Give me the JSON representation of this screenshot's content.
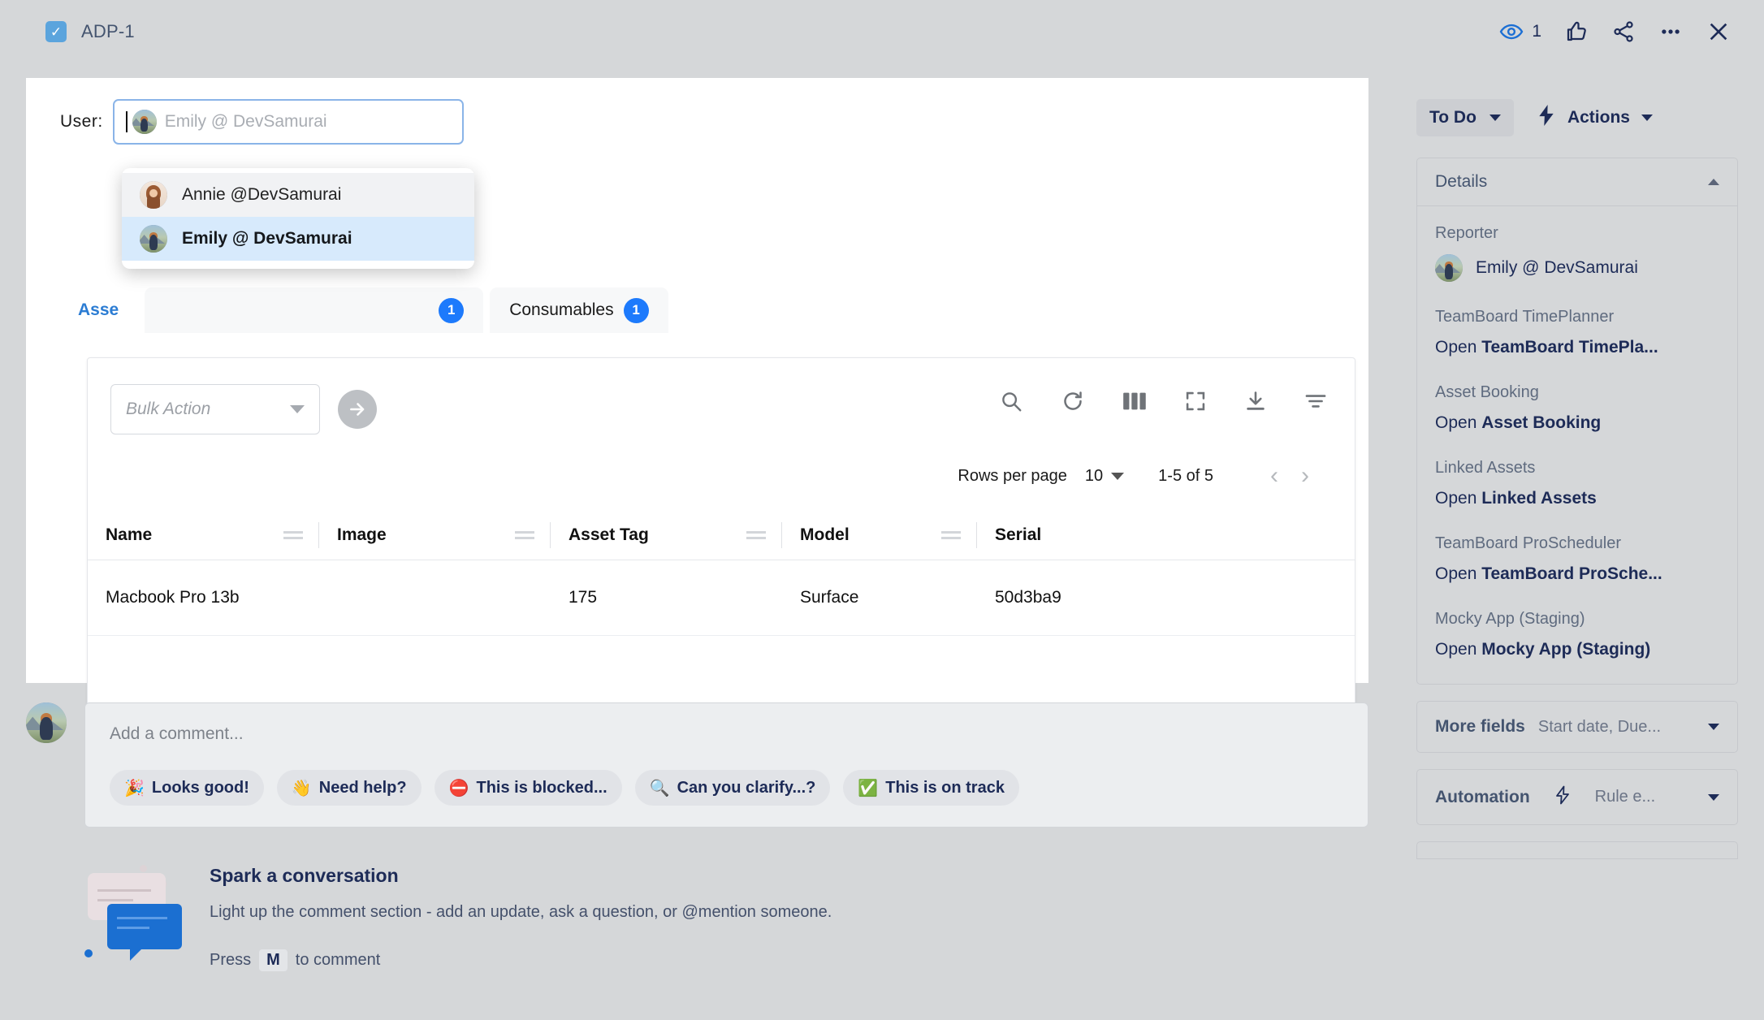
{
  "topbar": {
    "issue_key": "ADP-1",
    "check_glyph": "✓",
    "watch_count": "1",
    "icons": [
      "watch-eye-icon",
      "thumbs-up-icon",
      "share-icon",
      "more-actions-icon",
      "close-icon"
    ]
  },
  "user_field": {
    "label": "User:",
    "placeholder": "Emily @ DevSamurai",
    "value": ""
  },
  "dropdown": {
    "options": [
      {
        "name": "Annie @DevSamurai",
        "state": "hover"
      },
      {
        "name": "Emily @ DevSamurai",
        "state": "selected"
      }
    ]
  },
  "tabs": [
    {
      "label": "Asse",
      "badge": "",
      "active": true
    },
    {
      "label": "",
      "badge": "1",
      "active": false
    },
    {
      "label": "Consumables",
      "badge": "1",
      "active": false
    }
  ],
  "table_panel": {
    "bulk_action_placeholder": "Bulk Action",
    "go_button": "→",
    "tools": [
      "search-icon",
      "refresh-icon",
      "columns-icon",
      "fullscreen-icon",
      "download-icon",
      "filter-icon"
    ],
    "pagination": {
      "rows_per_page_label": "Rows per page",
      "rows_per_page_value": "10",
      "range": "1-5 of 5",
      "prev": "‹",
      "next": "›"
    },
    "columns": [
      "Name",
      "Image",
      "Asset Tag",
      "Model",
      "Serial"
    ],
    "rows": [
      {
        "name": "Macbook Pro 13b",
        "image": "",
        "asset_tag": "175",
        "model": "Surface",
        "serial": "50d3ba9"
      }
    ]
  },
  "comment": {
    "placeholder": "Add a comment...",
    "chips": [
      {
        "emoji": "🎉",
        "label": "Looks good!"
      },
      {
        "emoji": "👋",
        "label": "Need help?"
      },
      {
        "emoji": "⛔",
        "label": "This is blocked..."
      },
      {
        "emoji": "🔍",
        "label": "Can you clarify...?"
      },
      {
        "emoji": "✅",
        "label": "This is on track"
      }
    ],
    "spark": {
      "title": "Spark a conversation",
      "subtitle": "Light up the comment section - add an update, ask a question, or @mention someone.",
      "press_prefix": "Press",
      "press_key": "M",
      "press_suffix": "to comment"
    }
  },
  "sidebar": {
    "status": "To Do",
    "actions_label": "Actions",
    "details": {
      "title": "Details",
      "fields": [
        {
          "label": "Reporter",
          "type": "user",
          "value": "Emily @ DevSamurai"
        },
        {
          "label": "TeamBoard TimePlanner",
          "type": "link",
          "prefix": "Open ",
          "link": "TeamBoard TimePla..."
        },
        {
          "label": "Asset Booking",
          "type": "link",
          "prefix": "Open ",
          "link": "Asset Booking"
        },
        {
          "label": "Linked Assets",
          "type": "link",
          "prefix": "Open ",
          "link": "Linked Assets"
        },
        {
          "label": "TeamBoard ProScheduler",
          "type": "link",
          "prefix": "Open ",
          "link": "TeamBoard ProSche..."
        },
        {
          "label": "Mocky App (Staging)",
          "type": "link",
          "prefix": "Open ",
          "link": "Mocky App (Staging)"
        }
      ]
    },
    "more_fields": {
      "title": "More fields",
      "subtitle": "Start date, Due..."
    },
    "automation": {
      "title": "Automation",
      "subtitle": "Rule e..."
    }
  },
  "colors": {
    "accent_blue": "#2b7cd3",
    "badge_blue": "#1d7afc",
    "navy": "#1d2b57",
    "page_bg": "#d5d7d9"
  }
}
